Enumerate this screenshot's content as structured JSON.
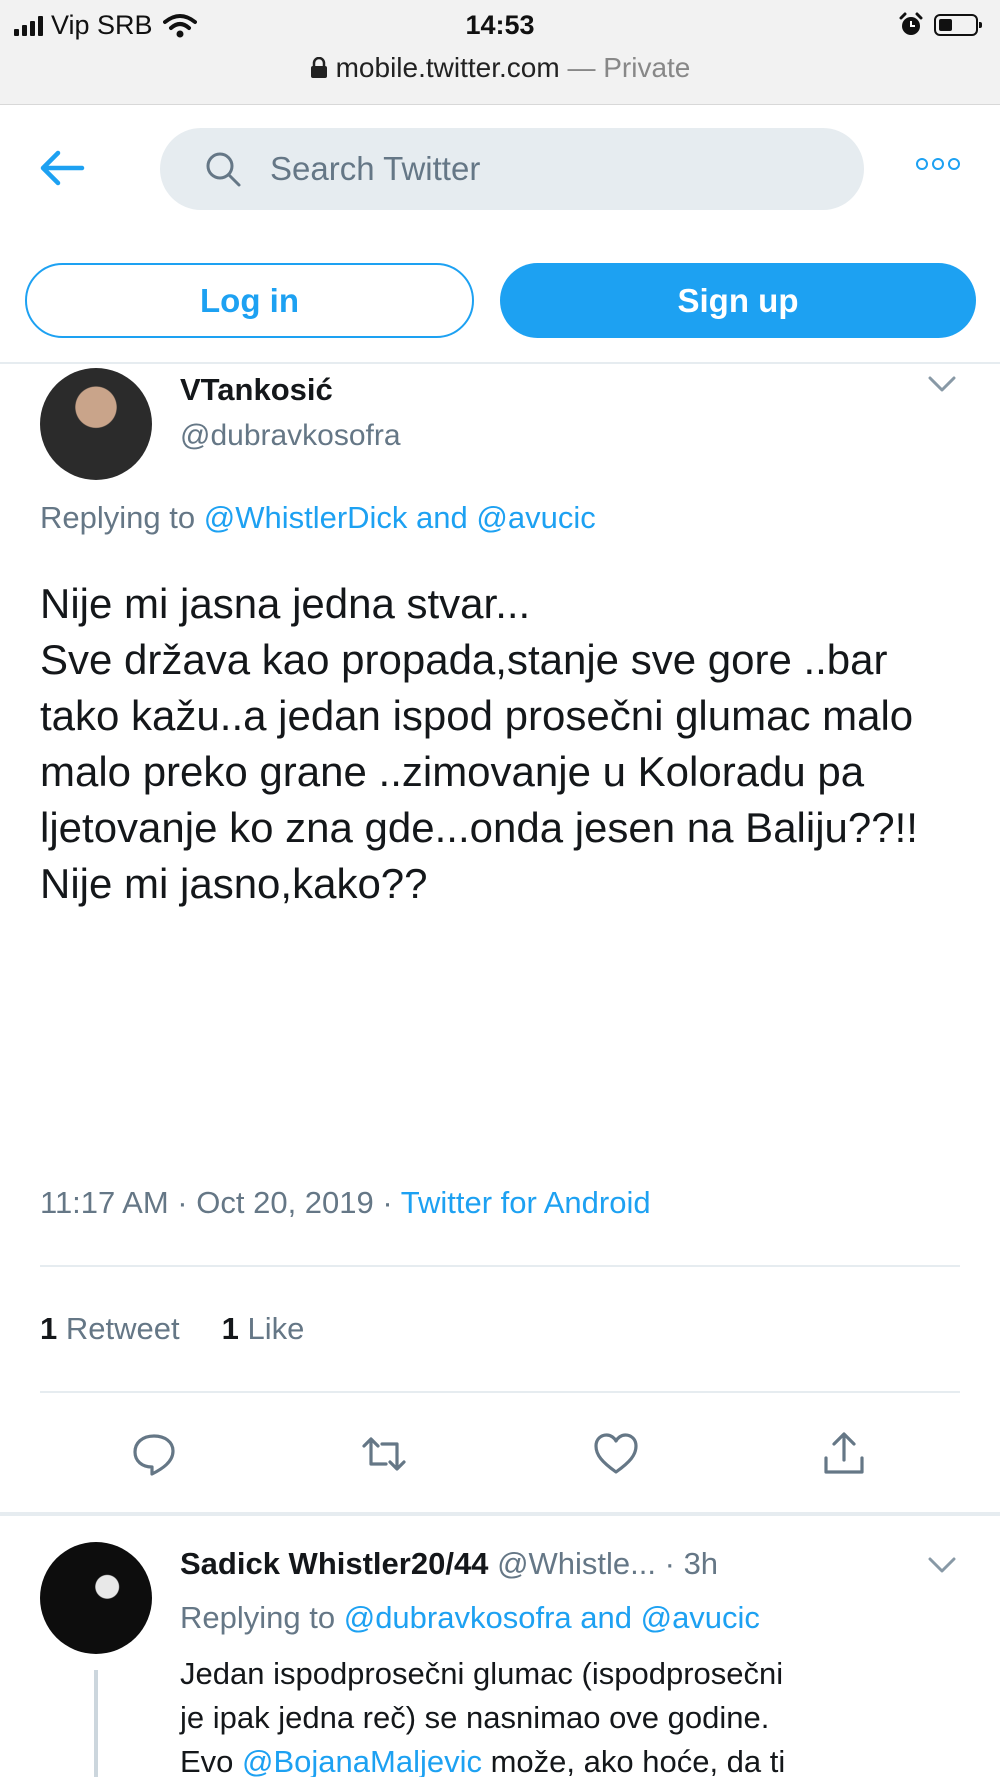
{
  "status_bar": {
    "carrier": "Vip SRB",
    "time": "14:53"
  },
  "url_bar": {
    "domain": "mobile.twitter.com",
    "separator": " — ",
    "mode": "Private"
  },
  "header": {
    "search_placeholder": "Search Twitter"
  },
  "auth": {
    "login_label": "Log in",
    "signup_label": "Sign up"
  },
  "tweet": {
    "author_name": "VTankosić",
    "author_handle": "@dubravkosofra",
    "replying_prefix": "Replying to ",
    "reply_user1": "@WhistlerDick",
    "reply_and": " and ",
    "reply_user2": "@avucic",
    "text": "Nije mi jasna jedna stvar...\nSve država kao propada,stanje sve gore ..bar tako kažu..a jedan ispod prosečni glumac malo malo preko grane ..zimovanje u Koloradu pa ljetovanje ko zna gde...onda jesen na Baliju??!!\nNije mi jasno,kako??",
    "time": "11:17 AM",
    "date": "Oct 20, 2019",
    "source": "Twitter for Android",
    "retweet_count": "1",
    "retweet_label": "Retweet",
    "like_count": "1",
    "like_label": "Like"
  },
  "reply": {
    "author_name": "Sadick Whistler20/44",
    "author_handle": "@Whistle...",
    "age": "3h",
    "replying_prefix": "Replying to ",
    "reply_user1": "@dubravkosofra",
    "reply_and": " and ",
    "reply_user2": "@avucic",
    "text_line1": "Jedan ispodprosečni glumac (ispodprosečni",
    "text_line2": "je ipak jedna reč) se nasnimao ove godine.",
    "text_line3_prefix": "Evo ",
    "text_line3_mention": "@BojanaMaljevic",
    "text_line3_rest": " može, ako hoće, da ti"
  },
  "colors": {
    "accent": "#1da1f2",
    "muted": "#657786",
    "text": "#14171a",
    "border": "#e6ecf0"
  },
  "icons": [
    "signal-icon",
    "wifi-icon",
    "alarm-icon",
    "battery-icon",
    "lock-icon",
    "back-arrow-icon",
    "search-icon",
    "more-icon",
    "chevron-down-icon",
    "reply-icon",
    "retweet-icon",
    "like-icon",
    "share-icon"
  ]
}
